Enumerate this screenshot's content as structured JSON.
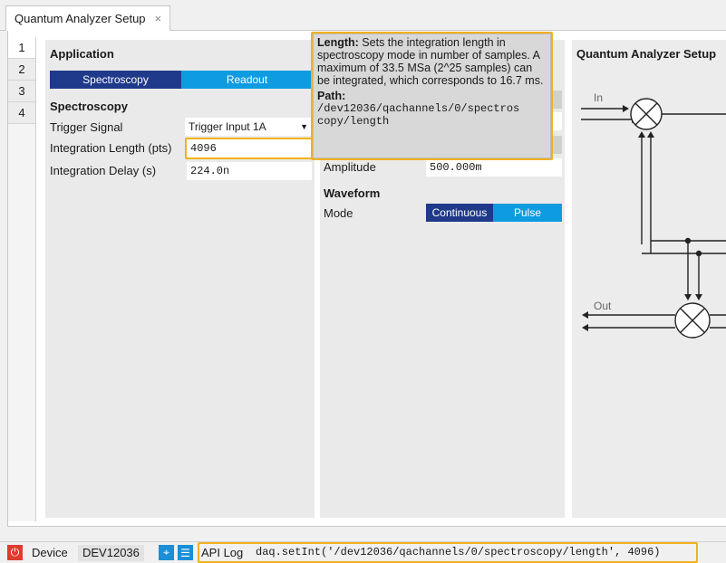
{
  "tab": {
    "title": "Quantum Analyzer Setup",
    "close": "×"
  },
  "sidetabs": [
    "1",
    "2",
    "3",
    "4"
  ],
  "application": {
    "title": "Application",
    "buttons": {
      "spectroscopy": "Spectroscopy",
      "readout": "Readout"
    },
    "section": "Spectroscopy",
    "trigger_label": "Trigger Signal",
    "trigger_value": "Trigger Input 1A",
    "length_label": "Integration Length (pts)",
    "length_value": "4096",
    "delay_label": "Integration Delay (s)",
    "delay_value": "224.0n"
  },
  "middle": {
    "amplitude_label": "Amplitude",
    "amplitude_value": "500.000m",
    "waveform_title": "Waveform",
    "mode_label": "Mode",
    "mode_continuous": "Continuous",
    "mode_pulse": "Pulse"
  },
  "diagram": {
    "title": "Quantum Analyzer Setup",
    "in_label": "In",
    "out_label": "Out"
  },
  "tooltip": {
    "heading": "Length:",
    "text": " Sets the integration length in spectroscopy mode in number of samples. A maximum of 33.5 MSa (2^25 samples) can be integrated, which corresponds to 16.7 ms.",
    "path_label": "Path:",
    "path_line1": "/dev12036/qachannels/0/spectros",
    "path_line2": "copy/length"
  },
  "status": {
    "device_label": "Device",
    "device_value": "DEV12036",
    "api_label": "API Log",
    "api_value": "daq.setInt('/dev12036/qachannels/0/spectroscopy/length', 4096)"
  },
  "colors": {
    "selected": "#1f3a8a",
    "unselected": "#0e9ce0",
    "highlight": "#f2b11d",
    "power": "#e03a2f"
  }
}
